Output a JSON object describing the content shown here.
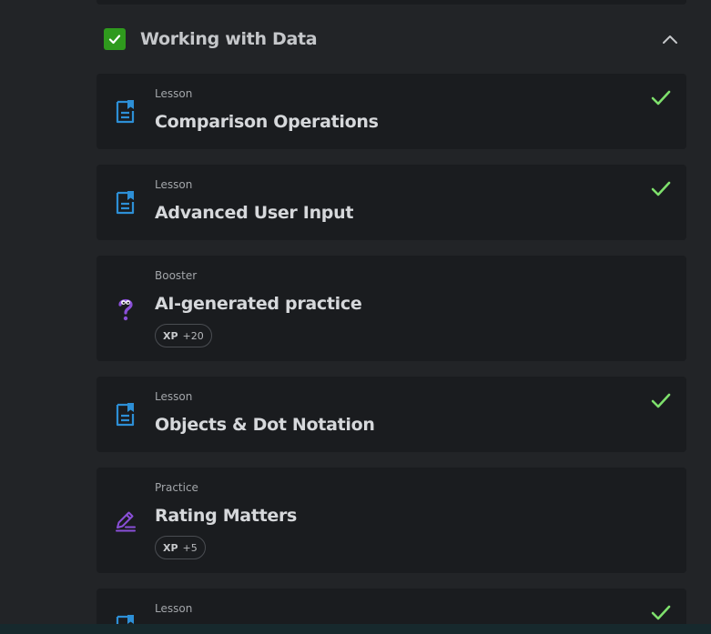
{
  "section": {
    "title": "Working with Data",
    "completed": true
  },
  "items": [
    {
      "type": "Lesson",
      "title": "Comparison Operations",
      "icon": "lesson-document-icon",
      "completed": true
    },
    {
      "type": "Lesson",
      "title": "Advanced User Input",
      "icon": "lesson-document-icon",
      "completed": true
    },
    {
      "type": "Booster",
      "title": "AI-generated practice",
      "icon": "ai-question-icon",
      "completed": false,
      "xp_label": "XP",
      "xp_value": "+20"
    },
    {
      "type": "Lesson",
      "title": "Objects & Dot Notation",
      "icon": "lesson-document-icon",
      "completed": true
    },
    {
      "type": "Practice",
      "title": "Rating Matters",
      "icon": "pencil-practice-icon",
      "completed": false,
      "xp_label": "XP",
      "xp_value": "+5"
    },
    {
      "type": "Lesson",
      "title": "",
      "icon": "lesson-document-icon",
      "completed": true
    }
  ],
  "colors": {
    "background": "#222427",
    "card": "#1a1c1f",
    "check_green": "#7ee06c",
    "section_check_bg": "#2f9a1d",
    "lesson_icon_blue": "#2d8fd6",
    "booster_purple": "#8a4fd8"
  }
}
